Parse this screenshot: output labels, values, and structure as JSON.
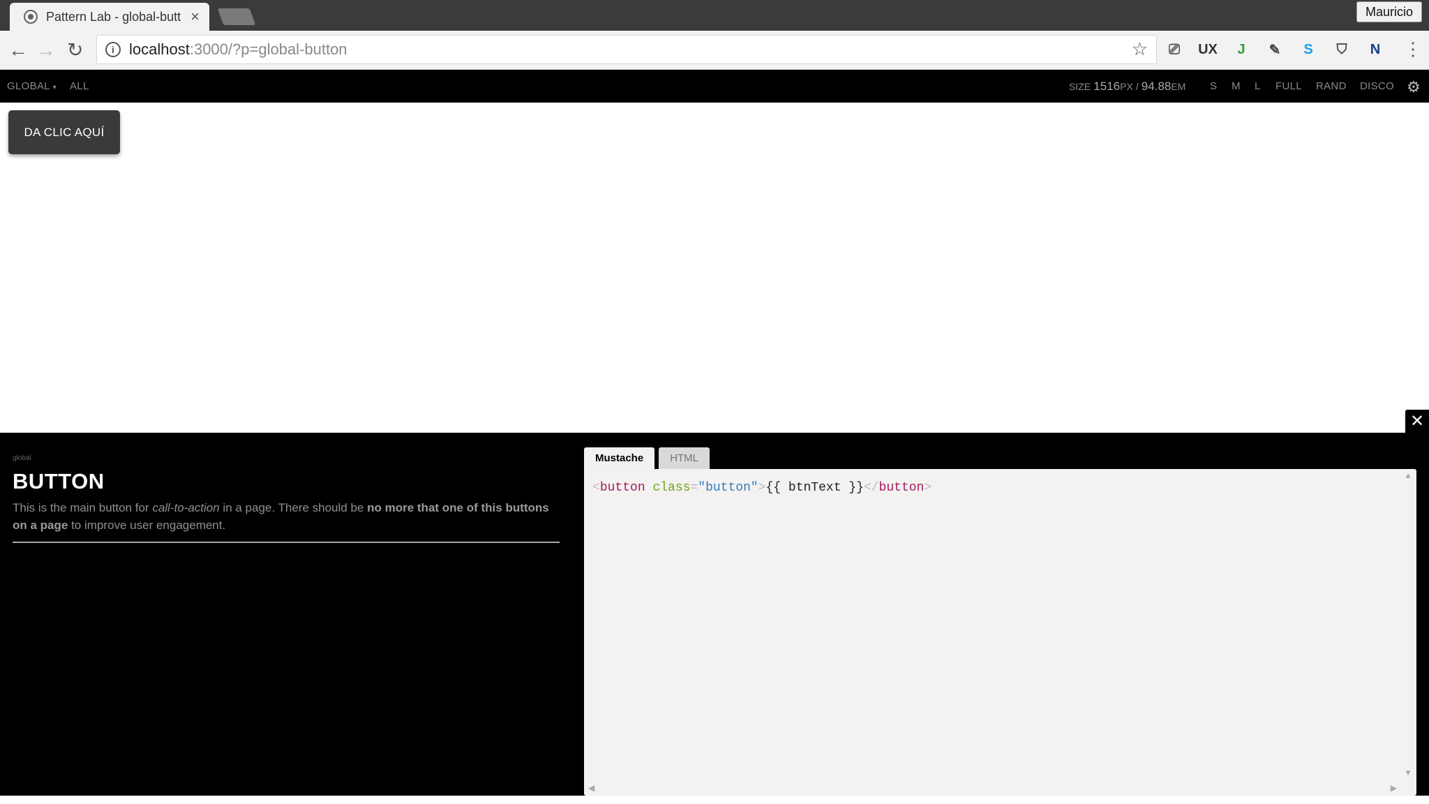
{
  "browser": {
    "tab_title": "Pattern Lab - global-butt",
    "tab_close": "×",
    "profile_name": "Mauricio",
    "url_host": "localhost",
    "url_rest": ":3000/?p=global-button",
    "nav": {
      "back": "←",
      "forward": "→",
      "reload": "↻",
      "star": "☆",
      "info": "i",
      "menu": "⋮"
    },
    "extensions": [
      {
        "icon": "cast-icon",
        "glyph": "⎚",
        "color": "#555555"
      },
      {
        "icon": "ux-check-icon",
        "glyph": "UX",
        "color": "#333333"
      },
      {
        "icon": "green-extension-icon",
        "glyph": "J",
        "color": "#3a9d3a"
      },
      {
        "icon": "eyedropper-icon",
        "glyph": "✎",
        "color": "#444444"
      },
      {
        "icon": "skype-icon",
        "glyph": "S",
        "color": "#1ea0e6"
      },
      {
        "icon": "shield-icon",
        "glyph": "⛉",
        "color": "#444444"
      },
      {
        "icon": "onenote-icon",
        "glyph": "N",
        "color": "#1a3d8f"
      }
    ]
  },
  "patternlab": {
    "nav": {
      "global": "GLOBAL",
      "global_caret": "▾",
      "all": "ALL",
      "size_label": "SIZE",
      "size_px": "1516",
      "size_px_unit": "PX /",
      "size_em": "94.88",
      "size_em_unit": "EM",
      "s": "S",
      "m": "M",
      "l": "L",
      "full": "FULL",
      "rand": "RAND",
      "disco": "DISCO",
      "gear": "⚙"
    },
    "viewport": {
      "button_text": "DA CLIC AQUÍ"
    },
    "drawer": {
      "close": "✕",
      "path": "global",
      "title": "BUTTON",
      "desc_1": "This is the main button for ",
      "desc_em": "call-to-action",
      "desc_2": " in a page. There should be ",
      "desc_bold": "no more that one of this buttons on a page",
      "desc_3": " to improve user engagement.",
      "tabs": {
        "mustache": "Mustache",
        "html": "HTML"
      },
      "code": {
        "open_lt": "<",
        "tag": "button",
        "sp": " ",
        "attr": "class",
        "eq": "=",
        "val": "\"button\"",
        "gt": ">",
        "expr": "{{ btnText }}",
        "close_lt": "</",
        "close_tag": "button",
        "close_gt": ">"
      },
      "scroll": {
        "up": "▲",
        "down": "▼",
        "left": "◀",
        "right": "▶"
      }
    }
  }
}
